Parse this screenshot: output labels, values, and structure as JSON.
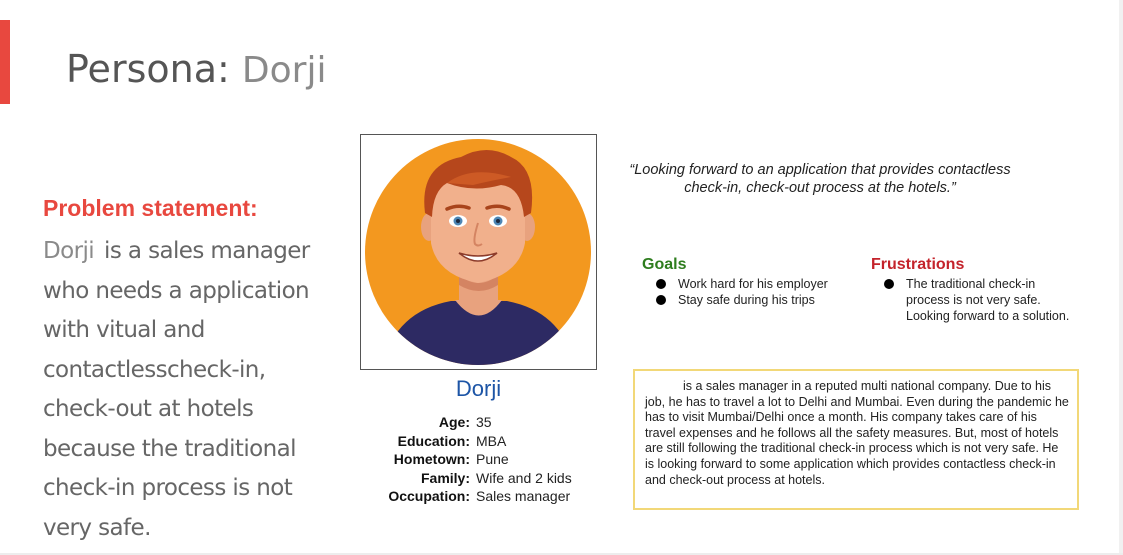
{
  "title": {
    "prefix": "Persona:",
    "name": "Dorji"
  },
  "problem_statement": {
    "heading": "Problem statement:",
    "name": "Dorji",
    "text": "is a sales manager who needs a application with vitual and contactlesscheck-in, check-out at hotels because the traditional check-in process is not very safe."
  },
  "profile": {
    "name": "Dorji",
    "details": [
      {
        "label": "Age:",
        "value": "35"
      },
      {
        "label": "Education:",
        "value": "MBA"
      },
      {
        "label": "Hometown:",
        "value": "Pune"
      },
      {
        "label": "Family:",
        "value": "Wife and 2 kids"
      },
      {
        "label": "Occupation:",
        "value": "Sales manager"
      }
    ]
  },
  "quote": {
    "line1": "“Looking forward to an application that provides contactless",
    "line2": "check-in, check-out process at the hotels.”"
  },
  "goals": {
    "heading": "Goals",
    "items": [
      "Work hard for his employer",
      "Stay safe during his trips"
    ]
  },
  "frustrations": {
    "heading": "Frustrations",
    "items": [
      "The traditional check-in process is not very safe. Looking forward to a solution."
    ]
  },
  "story": "is a sales manager in a reputed multi national company. Due to his job, he has to travel a lot to Delhi and Mumbai. Even during the pandemic he has to visit Mumbai/Delhi once a month. His company takes care of his travel expenses and he follows all the safety measures. But, most of hotels are still following the traditional check-in process which is not very safe. He is looking forward to some application which provides contactless check-in and check-out process at hotels.",
  "colors": {
    "accent": "#e8483f",
    "name_blue": "#1d55a6",
    "goals_green": "#2e7d1e",
    "frustrations_red": "#c4232b",
    "story_border": "#f2d878",
    "avatar_bg": "#f3981f"
  }
}
